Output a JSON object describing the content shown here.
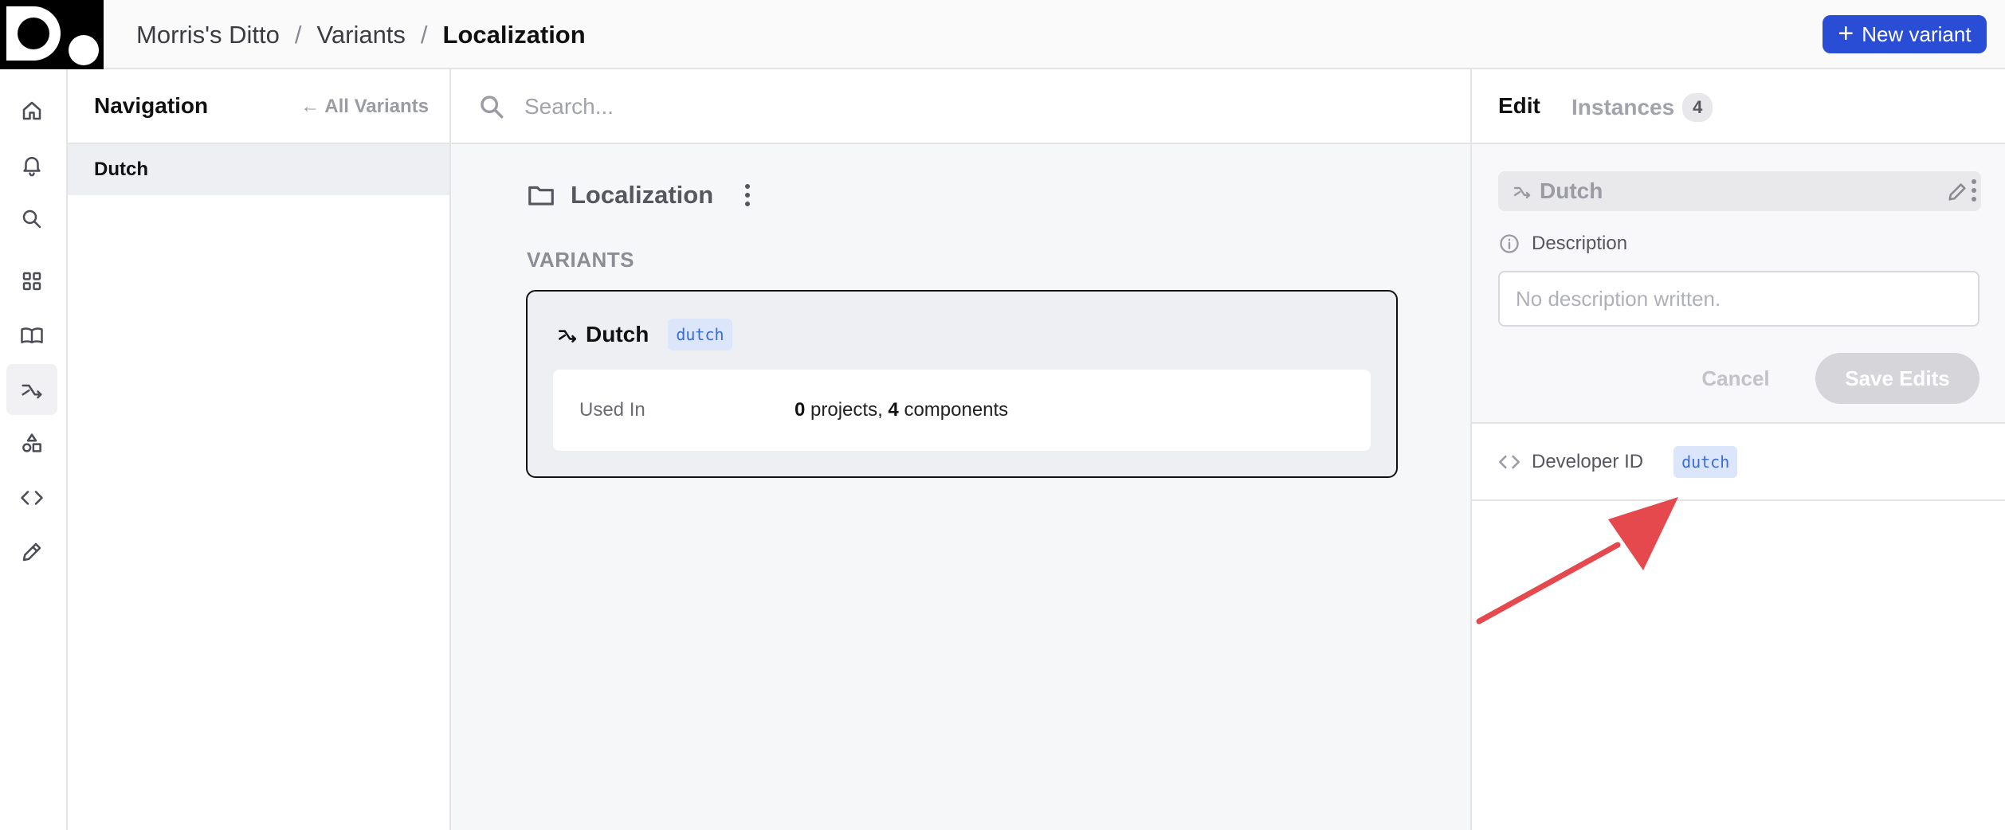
{
  "header": {
    "breadcrumb": [
      "Morris's Ditto",
      "Variants",
      "Localization"
    ],
    "separator": "/",
    "new_variant_label": "New variant"
  },
  "rail": {
    "icons": [
      "home-icon",
      "bell-icon",
      "search-icon",
      "grid-icon",
      "book-icon",
      "variant-icon",
      "shapes-icon",
      "code-icon",
      "pen-icon"
    ],
    "active": "variant-icon"
  },
  "navigation": {
    "title": "Navigation",
    "back_label": "All Variants",
    "items": [
      {
        "label": "Dutch",
        "active": true
      }
    ]
  },
  "search": {
    "placeholder": "Search..."
  },
  "folder": {
    "title": "Localization",
    "section_label": "VARIANTS",
    "variants": [
      {
        "name": "Dutch",
        "tag": "dutch",
        "used_in_label": "Used In",
        "projects_count": "0",
        "projects_word": "projects,",
        "components_count": "4",
        "components_word": "components"
      }
    ]
  },
  "edit_panel": {
    "tab_edit": "Edit",
    "tab_instances": "Instances",
    "instances_count": "4",
    "name": "Dutch",
    "description_label": "Description",
    "description_placeholder": "No description written.",
    "cancel_label": "Cancel",
    "save_label": "Save Edits",
    "developer_id_label": "Developer ID",
    "developer_id": "dutch"
  },
  "colors": {
    "accent": "#2a4dd6",
    "tag_text": "#3b6bd6",
    "tag_bg": "#dbe6fb",
    "annotation_arrow": "#e5484d"
  }
}
